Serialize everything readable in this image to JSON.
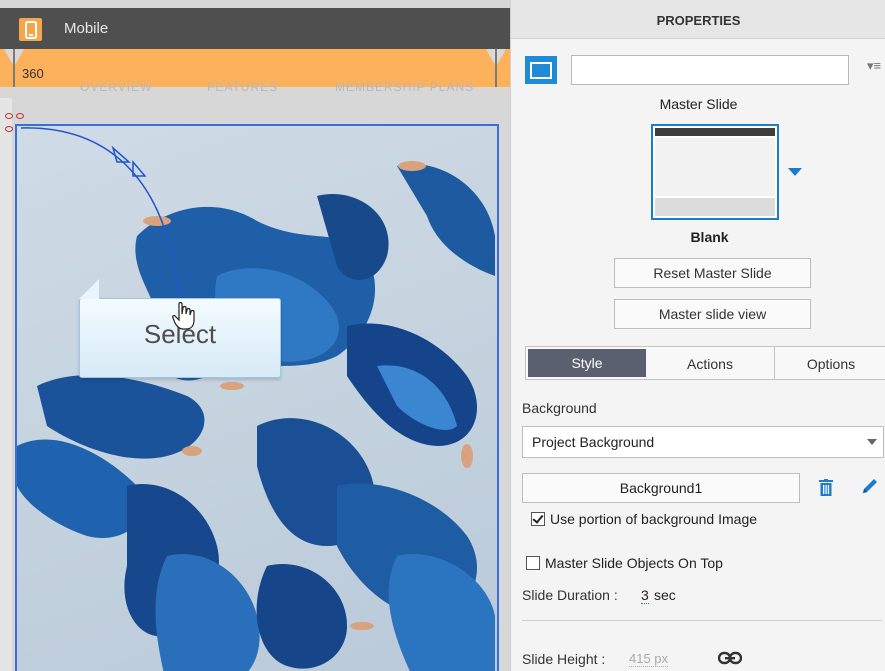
{
  "device": {
    "label": "Mobile",
    "width_value": "360"
  },
  "ghost_nav": [
    "OVERVIEW",
    "FEATURES",
    "MEMBERSHIP PLANS"
  ],
  "callout": {
    "text": "Select"
  },
  "panel": {
    "title": "PROPERTIES",
    "name_value": "",
    "master_slide_label": "Master Slide",
    "master_name": "Blank",
    "reset_button": "Reset Master Slide",
    "view_button": "Master slide view",
    "tabs": [
      "Style",
      "Actions",
      "Options"
    ],
    "background_label": "Background",
    "background_select": "Project Background",
    "background_button": "Background1",
    "use_portion_label": "Use portion of background Image",
    "use_portion_checked": true,
    "objects_on_top_label": "Master Slide Objects On Top",
    "objects_on_top_checked": false,
    "duration_label": "Slide Duration :",
    "duration_value": "3",
    "duration_unit": "sec",
    "height_label": "Slide Height :",
    "height_value": "415 px"
  },
  "colors": {
    "accent": "#1c7ccc",
    "ruler": "#fdb15b",
    "device_bar": "#4f4f4f",
    "tab_active": "#5a6070"
  }
}
